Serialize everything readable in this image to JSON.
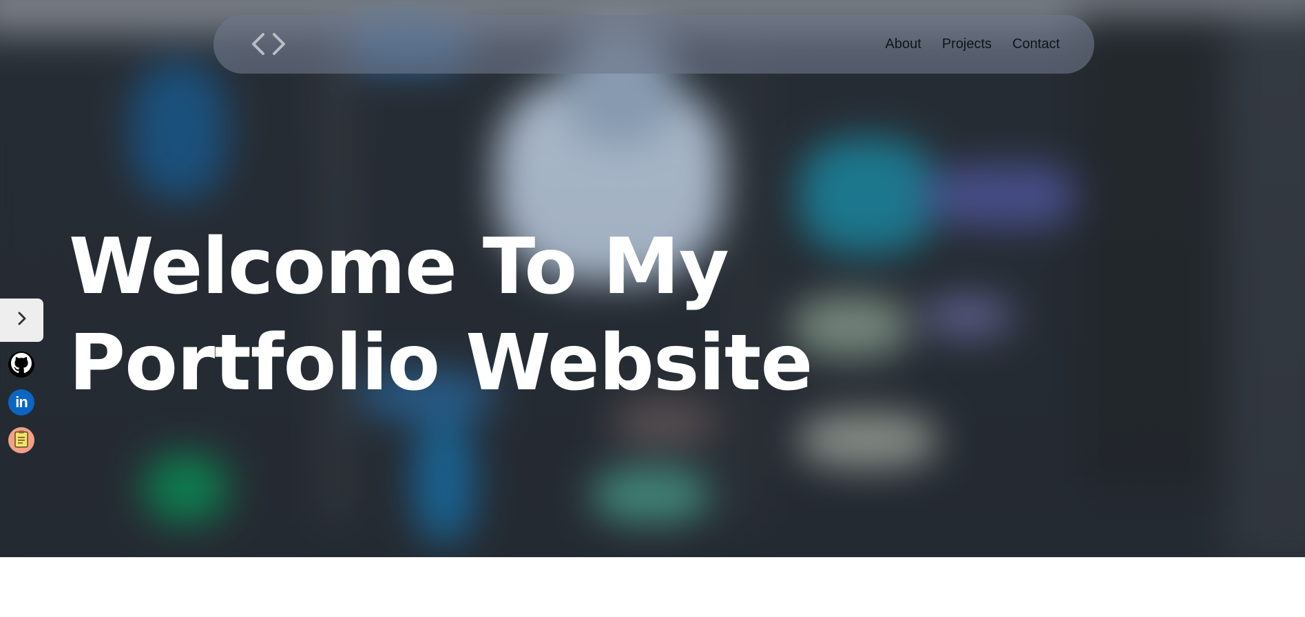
{
  "navbar": {
    "logo_icon": "code-brackets-icon",
    "links": [
      "About",
      "Projects",
      "Contact"
    ]
  },
  "hero": {
    "title_line1": "Welcome To My",
    "title_line2": "Portfolio Website"
  },
  "sidebar": {
    "toggle_icon": "chevron-right-icon",
    "socials": [
      {
        "name": "github",
        "icon": "github-icon"
      },
      {
        "name": "linkedin",
        "icon": "linkedin-icon",
        "text": "in"
      },
      {
        "name": "resume",
        "icon": "resume-icon"
      }
    ]
  },
  "colors": {
    "navbar_bg": "#6e788a",
    "nav_text": "#111418",
    "headline": "#ffffff",
    "linkedin": "#0a66c2",
    "resume_bg": "#f2a184"
  }
}
